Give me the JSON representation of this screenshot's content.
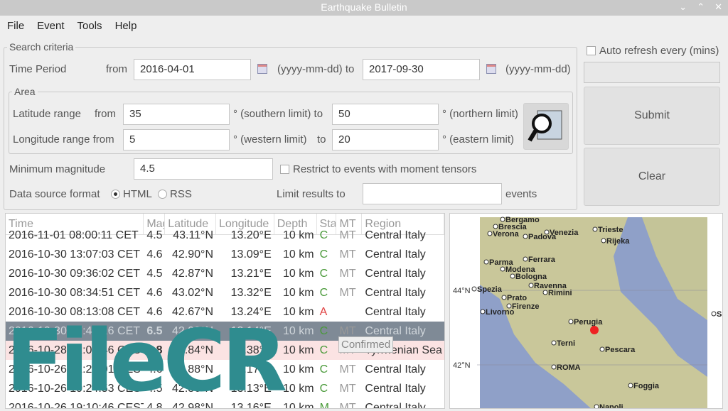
{
  "window": {
    "title": "Earthquake Bulletin"
  },
  "menu": [
    "File",
    "Event",
    "Tools",
    "Help"
  ],
  "search": {
    "legend": "Search criteria",
    "time_label": "Time Period",
    "from_label": "from",
    "from_value": "2016-04-01",
    "format1": "(yyyy-mm-dd) to",
    "to_value": "2017-09-30",
    "format2": "(yyyy-mm-dd)",
    "area": {
      "legend": "Area",
      "lat_label": "Latitude range",
      "lat_from": "from",
      "lat_min": "35",
      "lat_min_note": "° (southern limit) to",
      "lat_max": "50",
      "lat_max_note": "° (northern limit)",
      "lon_label": "Longitude range from",
      "lon_min": "5",
      "lon_min_note": "° (western limit)",
      "lon_to": "to",
      "lon_max": "20",
      "lon_max_note": "° (eastern limit)"
    },
    "mag_label": "Minimum magnitude",
    "mag_value": "4.5",
    "mt_label": "Restrict to events with moment tensors",
    "format_label": "Data source format",
    "format_html": "HTML",
    "format_rss": "RSS",
    "limit_label": "Limit results to",
    "limit_value": "",
    "limit_suffix": "events"
  },
  "side": {
    "auto_refresh": "Auto refresh every (mins)",
    "refresh_value": "",
    "submit": "Submit",
    "clear": "Clear"
  },
  "table": {
    "headers": [
      "Time",
      "Mag",
      "Latitude",
      "Longitude",
      "Depth",
      "Sta",
      "MT",
      "Region"
    ],
    "rows": [
      [
        "2016-11-01 08:00:11 CET",
        "4.5",
        "43.11°N",
        "13.20°E",
        "10 km",
        "C",
        "MT",
        "Central Italy"
      ],
      [
        "2016-10-30 13:07:03 CET",
        "4.6",
        "42.90°N",
        "13.09°E",
        "10 km",
        "C",
        "MT",
        "Central Italy"
      ],
      [
        "2016-10-30 09:36:02 CET",
        "4.5",
        "42.87°N",
        "13.21°E",
        "10 km",
        "C",
        "MT",
        "Central Italy"
      ],
      [
        "2016-10-30 08:34:51 CET",
        "4.6",
        "43.02°N",
        "13.32°E",
        "10 km",
        "C",
        "MT",
        "Central Italy"
      ],
      [
        "2016-10-30 08:13:08 CET",
        "4.6",
        "42.67°N",
        "13.24°E",
        "10 km",
        "A",
        "",
        "Central Italy"
      ],
      [
        "2016-10-30 07:40:16 CET",
        "6.5",
        "42.92°N",
        "13.14°E",
        "10 km",
        "C",
        "MT",
        "Central Italy"
      ],
      [
        "2016-10-28 22:02:46 CEST",
        "5.8",
        "39.84°N",
        "13.38°E",
        "10 km",
        "C",
        "MT",
        "Tyrrhenian Sea"
      ],
      [
        "2016-10-26 21:20:01 CEST",
        "4.6",
        "42.88°N",
        "13.17°E",
        "10 km",
        "C",
        "MT",
        "Central Italy"
      ],
      [
        "2016-10-26 19:24:53 CEST",
        "4.5",
        "42.86°N",
        "13.13°E",
        "10 km",
        "C",
        "MT",
        "Central Italy"
      ],
      [
        "2016-10-26 19:10:46 CEST",
        "4.8",
        "42.98°N",
        "13.16°E",
        "10 km",
        "M",
        "MT",
        "Central Italy"
      ]
    ]
  },
  "tooltip": "Confirmed",
  "map": {
    "lat_ticks": [
      "44°N",
      "42°N"
    ],
    "cities": [
      "Bergamo",
      "Brescia",
      "Verona",
      "Padova",
      "Venezia",
      "Trieste",
      "Rijeka",
      "Parma",
      "Ferrara",
      "Modena",
      "Bologna",
      "Ravenna",
      "Rimini",
      "Spezia",
      "Prato",
      "Firenze",
      "Livorno",
      "Perugia",
      "Terni",
      "Pescara",
      "ROMA",
      "Foggia",
      "Napoli",
      "Split"
    ]
  },
  "watermark": "FileCR",
  "colors": {
    "status_c": "#4a9a3a",
    "status_a": "#e04040",
    "selected": "#7f8a96",
    "epicenter": "#ee2222"
  }
}
